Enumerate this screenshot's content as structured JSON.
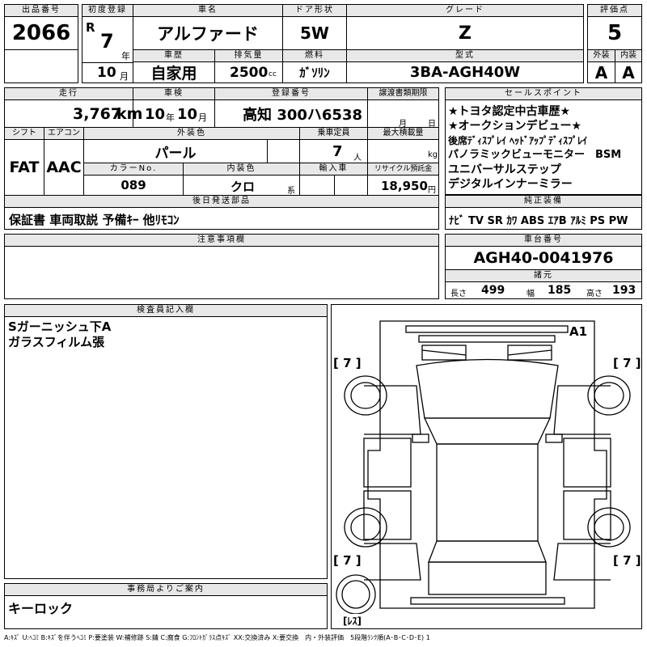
{
  "header": {
    "lot_no_label": "出品番号",
    "lot_no": "2066",
    "first_reg_label": "初度登録",
    "era": "R",
    "year": "7",
    "year_unit": "年",
    "month": "10",
    "month_unit": "月",
    "car_name_label": "車名",
    "car_name": "アルファード",
    "door_label": "ドア形状",
    "door": "5W",
    "grade_label": "グレード",
    "grade": "Z",
    "score_label": "評価点",
    "score": "5",
    "history_label": "車歴",
    "history": "自家用",
    "displacement_label": "排気量",
    "displacement": "2500",
    "displacement_unit": "cc",
    "fuel_label": "燃料",
    "fuel": "ｶﾞｿﾘﾝ",
    "model_label": "型式",
    "model": "3BA-AGH40W",
    "exterior_label": "外装",
    "exterior": "A",
    "interior_label": "内装",
    "interior": "A"
  },
  "row2": {
    "mileage_label": "走行",
    "mileage": "3,767",
    "mileage_unit": "km",
    "inspection_label": "車検",
    "insp_year": "10",
    "insp_year_unit": "年",
    "insp_month": "10",
    "insp_month_unit": "月",
    "plate_label": "登録番号",
    "plate": "高知 300ハ6538",
    "transfer_label": "譲渡書類期限",
    "transfer_month_unit": "月",
    "transfer_day_unit": "日",
    "shift_label": "シフト",
    "shift": "FAT",
    "ac_label": "エアコン",
    "ac": "AAC",
    "color_label": "外装色",
    "color": "パール",
    "capacity_label": "乗車定員",
    "capacity": "7",
    "capacity_unit": "人",
    "load_label": "最大積載量",
    "load_unit": "kg",
    "color_no_label": "カラーNo.",
    "color_no": "089",
    "int_color_label": "内装色",
    "int_color": "クロ",
    "int_color_unit": "系",
    "import_label": "輸入車",
    "recycle_label": "リサイクル預託金",
    "recycle": "18,950",
    "recycle_unit": "円",
    "later_label": "後日発送部品",
    "later": "保証書 車両取説 予備ｷｰ 他ﾘﾓｺﾝ"
  },
  "selling_points": {
    "label": "セールスポイント",
    "lines": [
      "★トヨタ認定中古車歴★",
      "★オークションデビュー★",
      "後席ﾃﾞｨｽﾌﾟﾚｲ ﾍｯﾄﾞｱｯﾌﾟﾃﾞｨｽﾌﾟﾚｲ",
      "パノラミックビューモニター　BSM",
      "ユニバーサルステップ",
      "デジタルインナーミラー"
    ]
  },
  "equipment": {
    "label": "純正装備",
    "items": "ﾅﾋﾞ TV SR ｶﾜ ABS ｴｱB ｱﾙﾐ PS PW"
  },
  "caution": {
    "label": "注意事項欄"
  },
  "chassis": {
    "label": "車台番号",
    "number": "AGH40-0041976"
  },
  "specs": {
    "label": "諸元",
    "length_label": "長さ",
    "length": "499",
    "width_label": "幅",
    "width": "185",
    "height_label": "高さ",
    "height": "193"
  },
  "inspector": {
    "label": "検査員記入欄",
    "lines": [
      "Sガーニッシュ下A",
      "ガラスフィルム張"
    ]
  },
  "diagram": {
    "mark_a1": "A1",
    "tire_fl": "[ 7 ]",
    "tire_fr": "[ 7 ]",
    "tire_rl": "[ 7 ]",
    "tire_rr": "[ 7 ]",
    "spare": "[ﾚｽ]"
  },
  "office": {
    "label": "事務局よりご案内",
    "text": "キーロック"
  },
  "legend": "A:ｷｽﾞ U:ﾍｺﾐ B:ｷｽﾞを伴うﾍｺﾐ P:要塗装 W:補修跡 S:錆 C:腐食 G:ﾌﾛﾝﾄｶﾞﾗｽ点ｷｽﾞ XX:交換済み X:要交換　内・外装評価　5段階ﾗﾝｸ順(A･B･C･D･E) 1"
}
